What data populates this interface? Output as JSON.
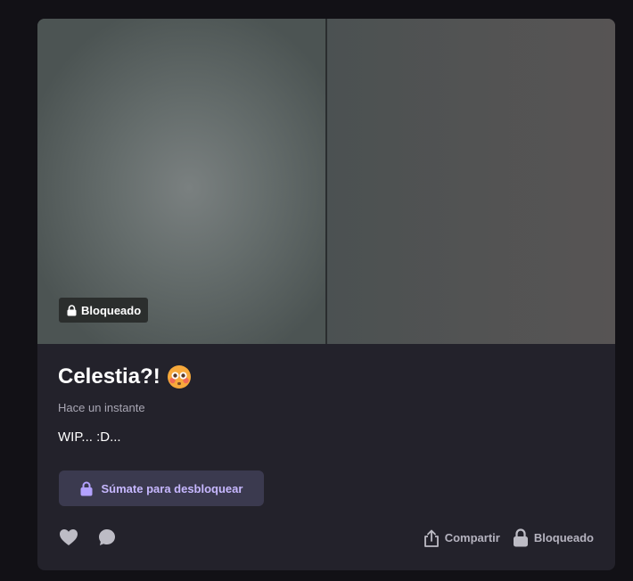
{
  "post": {
    "title": "Celestia?!",
    "timestamp": "Hace un instante",
    "body": "WIP... :D...",
    "locked_badge": "Bloqueado"
  },
  "unlock": {
    "label": "Súmate para desbloquear"
  },
  "actions": {
    "like_icon": "heart-icon",
    "comment_icon": "comment-icon",
    "share_label": "Compartir",
    "locked_label": "Bloqueado"
  },
  "colors": {
    "background": "#121116",
    "card": "#23222b",
    "accent": "#c7b8ff",
    "button_bg": "#3b3a4f"
  }
}
